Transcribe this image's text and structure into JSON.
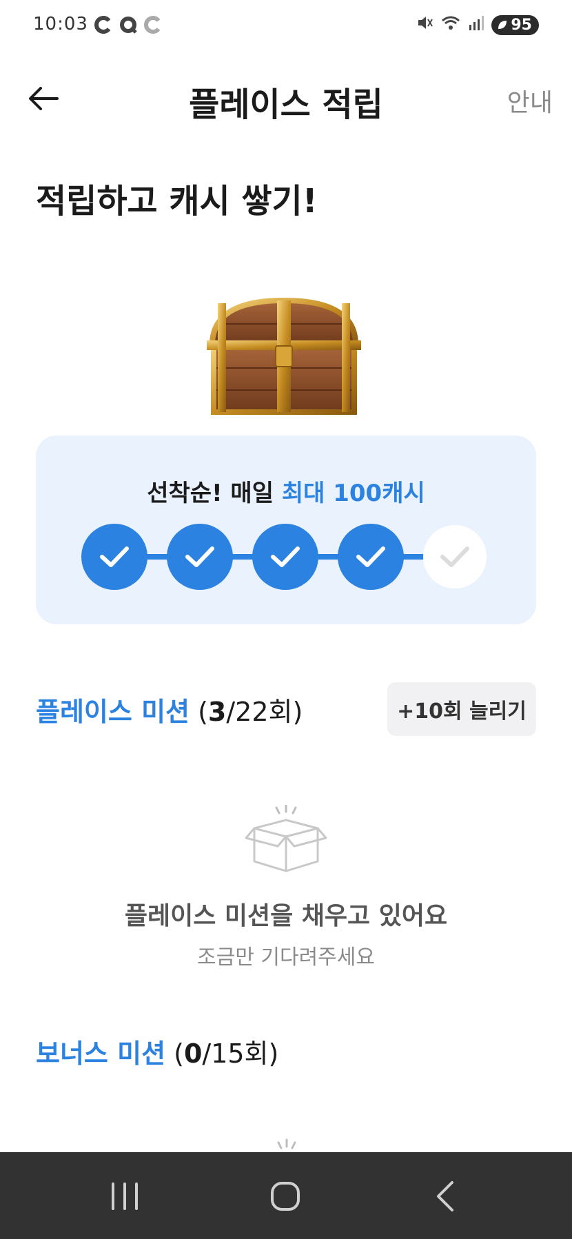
{
  "status_bar": {
    "time": "10:03",
    "left_icons": [
      "notification-icon-1",
      "notification-icon-2",
      "notification-icon-3"
    ],
    "right_icons": [
      "mute-icon",
      "wifi-icon",
      "signal-icon"
    ],
    "battery": "95"
  },
  "header": {
    "title": "플레이스 적립",
    "guide_label": "안내"
  },
  "main": {
    "headline": "적립하고 캐시 쌓기!"
  },
  "progress_card": {
    "heading_prefix": "선착순! 매일 ",
    "heading_accent": "최대 100캐시",
    "steps": [
      {
        "state": "done"
      },
      {
        "state": "done"
      },
      {
        "state": "done"
      },
      {
        "state": "done"
      },
      {
        "state": "todo"
      }
    ]
  },
  "place_mission": {
    "name": "플레이스 미션",
    "count_open": " (",
    "count_done": "3",
    "count_rest": "/22회)",
    "more_button": "+10회 늘리기"
  },
  "empty_state": {
    "title": "플레이스 미션을 채우고 있어요",
    "subtitle": "조금만 기다려주세요"
  },
  "bonus_mission": {
    "name": "보너스 미션",
    "count_open": " (",
    "count_done": "0",
    "count_rest": "/15회)"
  },
  "colors": {
    "accent": "#2c82e0",
    "card_bg": "#eaf2fe",
    "nav_bg": "#323232"
  }
}
